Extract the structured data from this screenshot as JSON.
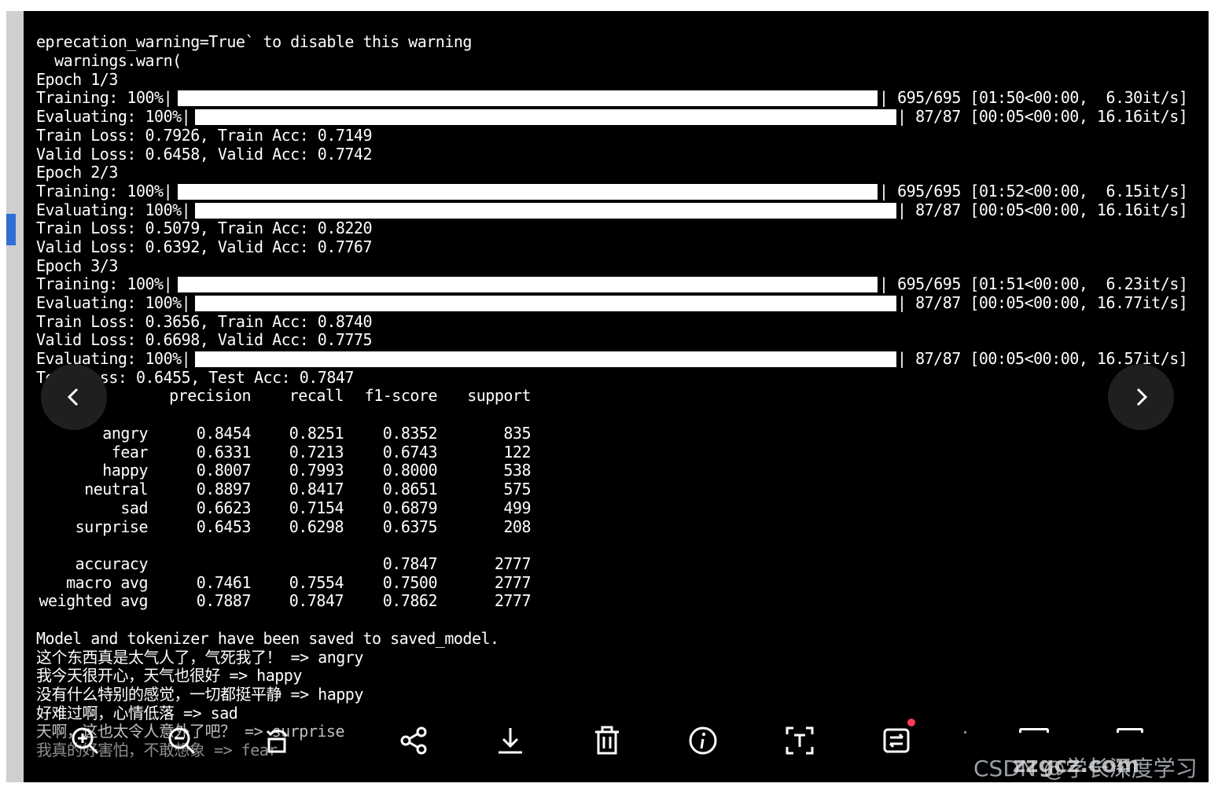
{
  "terminal": {
    "header_lines": [
      "eprecation_warning=True` to disable this warning",
      "  warnings.warn("
    ],
    "epochs": [
      {
        "label": "Epoch 1/3",
        "train_progress": {
          "prefix": "Training: 100%|",
          "suffix": "| 695/695 [01:50<00:00,  6.30it/s]",
          "fraction": 1.0
        },
        "eval_progress": {
          "prefix": "Evaluating: 100%|",
          "suffix": "| 87/87 [00:05<00:00, 16.16it/s]",
          "fraction": 1.0
        },
        "train_line": "Train Loss: 0.7926, Train Acc: 0.7149",
        "valid_line": "Valid Loss: 0.6458, Valid Acc: 0.7742"
      },
      {
        "label": "Epoch 2/3",
        "train_progress": {
          "prefix": "Training: 100%|",
          "suffix": "| 695/695 [01:52<00:00,  6.15it/s]",
          "fraction": 1.0
        },
        "eval_progress": {
          "prefix": "Evaluating: 100%|",
          "suffix": "| 87/87 [00:05<00:00, 16.16it/s]",
          "fraction": 1.0
        },
        "train_line": "Train Loss: 0.5079, Train Acc: 0.8220",
        "valid_line": "Valid Loss: 0.6392, Valid Acc: 0.7767"
      },
      {
        "label": "Epoch 3/3",
        "train_progress": {
          "prefix": "Training: 100%|",
          "suffix": "| 695/695 [01:51<00:00,  6.23it/s]",
          "fraction": 1.0
        },
        "eval_progress": {
          "prefix": "Evaluating: 100%|",
          "suffix": "| 87/87 [00:05<00:00, 16.77it/s]",
          "fraction": 1.0
        },
        "train_line": "Train Loss: 0.3656, Train Acc: 0.8740",
        "valid_line": "Valid Loss: 0.6698, Valid Acc: 0.7775"
      }
    ],
    "test_eval": {
      "prefix": "Evaluating: 100%|",
      "suffix": "| 87/87 [00:05<00:00, 16.57it/s]",
      "fraction": 1.0
    },
    "test_line": "Test Loss: 0.6455, Test Acc: 0.7847",
    "report": {
      "columns": [
        "precision",
        "recall",
        "f1-score",
        "support"
      ],
      "rows": [
        [
          "angry",
          "0.8454",
          "0.8251",
          "0.8352",
          "835"
        ],
        [
          "fear",
          "0.6331",
          "0.7213",
          "0.6743",
          "122"
        ],
        [
          "happy",
          "0.8007",
          "0.7993",
          "0.8000",
          "538"
        ],
        [
          "neutral",
          "0.8897",
          "0.8417",
          "0.8651",
          "575"
        ],
        [
          "sad",
          "0.6623",
          "0.7154",
          "0.6879",
          "499"
        ],
        [
          "surprise",
          "0.6453",
          "0.6298",
          "0.6375",
          "208"
        ]
      ],
      "summary": [
        [
          "accuracy",
          "",
          "",
          "0.7847",
          "2777"
        ],
        [
          "macro avg",
          "0.7461",
          "0.7554",
          "0.7500",
          "2777"
        ],
        [
          "weighted avg",
          "0.7887",
          "0.7847",
          "0.7862",
          "2777"
        ]
      ]
    },
    "saved_line": "Model and tokenizer have been saved to saved_model.",
    "predictions": [
      "这个东西真是太气人了，气死我了！ => angry",
      "我今天很开心，天气也很好 => happy",
      "没有什么特别的感觉，一切都挺平静 => happy",
      "好难过啊，心情低落 => sad",
      "天啊，这也太令人意外了吧？ => surprise",
      "我真的好害怕，不敢想象 => fear"
    ]
  },
  "viewer": {
    "toolbar": [
      {
        "name": "zoom-in-icon"
      },
      {
        "name": "zoom-out-icon"
      },
      {
        "name": "rotate-icon"
      },
      {
        "name": "share-icon"
      },
      {
        "name": "download-icon"
      },
      {
        "name": "delete-icon"
      },
      {
        "name": "info-icon"
      },
      {
        "name": "text-recognize-icon"
      },
      {
        "name": "translate-icon"
      }
    ],
    "badge_color": "#ff3b55"
  },
  "watermark": "CSDN @学长深度学习",
  "overlay_watermark": "zzgcz.com"
}
